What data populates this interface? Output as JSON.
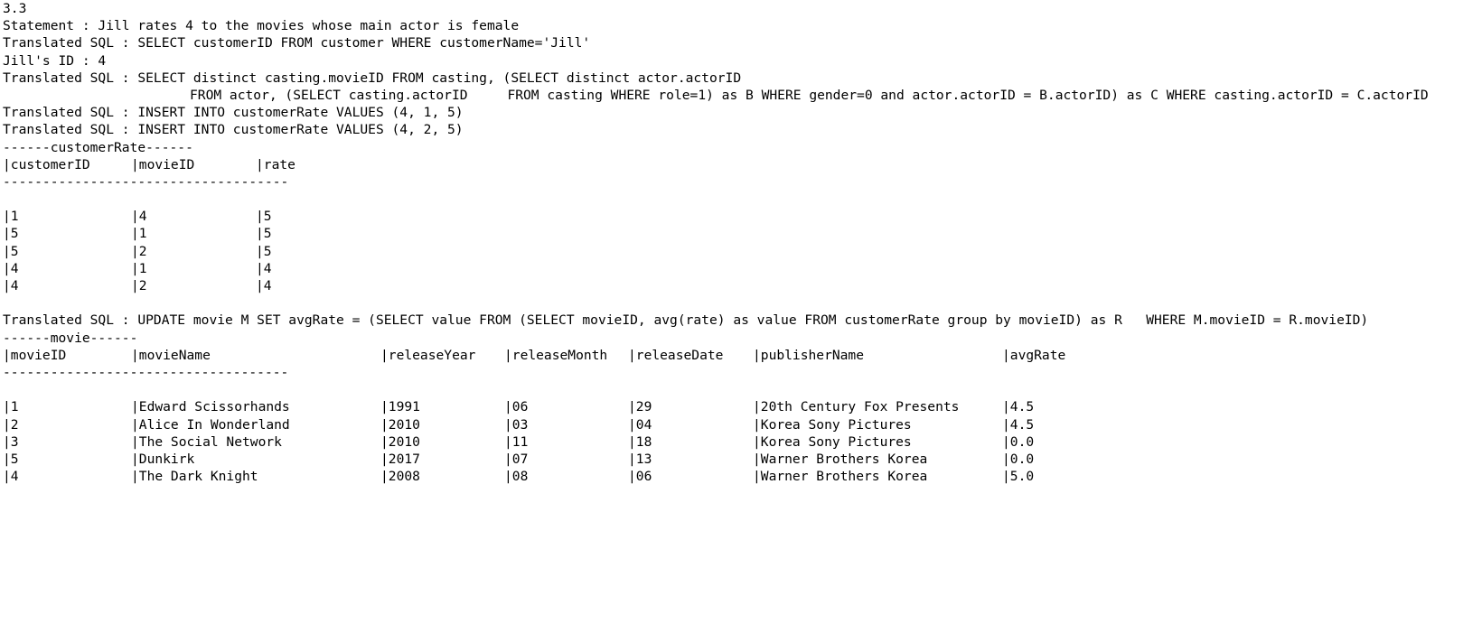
{
  "console": {
    "section": "3.3",
    "statement": "Statement : Jill rates 4 to the movies whose main actor is female",
    "sql_lookup": "Translated SQL : SELECT customerID FROM customer WHERE customerName='Jill'",
    "jill_id": "Jill's ID : 4",
    "sql_casting_1": "Translated SQL : SELECT distinct casting.movieID FROM casting, (SELECT distinct actor.actorID",
    "sql_casting_2": "FROM actor, (SELECT casting.actorID     FROM casting WHERE role=1) as B WHERE gender=0 and actor.actorID = B.actorID) as C WHERE casting.actorID = C.actorID",
    "sql_insert_1": "Translated SQL : INSERT INTO customerRate VALUES (4, 1, 5)",
    "sql_insert_2": "Translated SQL : INSERT INTO customerRate VALUES (4, 2, 5)",
    "rate_table": {
      "title": "------customerRate------",
      "headers": [
        "|customerID",
        "|movieID",
        "|rate"
      ],
      "divider": "------------------------------------",
      "rows": [
        [
          "|1",
          "|4",
          "|5"
        ],
        [
          "|5",
          "|1",
          "|5"
        ],
        [
          "|5",
          "|2",
          "|5"
        ],
        [
          "|4",
          "|1",
          "|4"
        ],
        [
          "|4",
          "|2",
          "|4"
        ]
      ]
    },
    "sql_update": "Translated SQL : UPDATE movie M SET avgRate = (SELECT value FROM (SELECT movieID, avg(rate) as value FROM customerRate group by movieID) as R   WHERE M.movieID = R.movieID)",
    "movie_table": {
      "title": "------movie------",
      "headers": [
        "|movieID",
        "|movieName",
        "|releaseYear",
        "|releaseMonth",
        "|releaseDate",
        "|publisherName",
        "|avgRate"
      ],
      "divider": "------------------------------------",
      "rows": [
        [
          "|1",
          "|Edward Scissorhands",
          "|1991",
          "|06",
          "|29",
          "|20th Century Fox Presents",
          "|4.5"
        ],
        [
          "|2",
          "|Alice In Wonderland",
          "|2010",
          "|03",
          "|04",
          "|Korea Sony Pictures",
          "|4.5"
        ],
        [
          "|3",
          "|The Social Network",
          "|2010",
          "|11",
          "|18",
          "|Korea Sony Pictures",
          "|0.0"
        ],
        [
          "|5",
          "|Dunkirk",
          "|2017",
          "|07",
          "|13",
          "|Warner Brothers Korea",
          "|0.0"
        ],
        [
          "|4",
          "|The Dark Knight",
          "|2008",
          "|08",
          "|06",
          "|Warner Brothers Korea",
          "|5.0"
        ]
      ]
    }
  }
}
